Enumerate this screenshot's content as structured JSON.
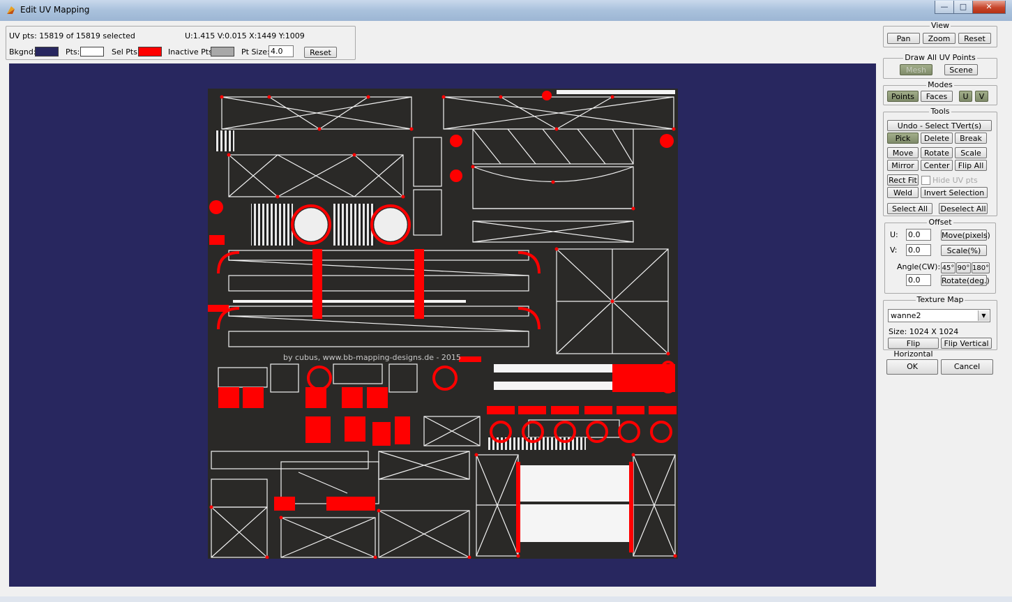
{
  "window": {
    "title": "Edit UV Mapping",
    "minimize": "—",
    "maximize": "□",
    "close": "✕"
  },
  "status": {
    "uv_pts": "UV pts: 15819 of 15819 selected",
    "coords": "U:1.415  V:0.015  X:1449  Y:1009",
    "bkgnd_label": "Bkgnd:",
    "pts_label": "Pts:",
    "sel_pts_label": "Sel Pts:",
    "inactive_pts_label": "Inactive Pts:",
    "pt_size_label": "Pt Size:",
    "pt_size_value": "4.0",
    "reset": "Reset"
  },
  "colors": {
    "background": "#28275f",
    "points": "#ffffff",
    "selected_points": "#ff0000",
    "inactive_points": "#a8a8a8"
  },
  "texture_credit": "by cubus, www.bb-mapping-designs.de - 2015",
  "panel": {
    "view": {
      "title": "View",
      "pan": "Pan",
      "zoom": "Zoom",
      "reset": "Reset"
    },
    "draw_all": {
      "title": "Draw All UV Points",
      "mesh": "Mesh",
      "scene": "Scene"
    },
    "modes": {
      "title": "Modes",
      "points": "Points",
      "faces": "Faces",
      "u": "U",
      "v": "V"
    },
    "tools": {
      "title": "Tools",
      "undo": "Undo - Select TVert(s)",
      "pick": "Pick",
      "delete": "Delete",
      "break": "Break",
      "move": "Move",
      "rotate": "Rotate",
      "scale": "Scale",
      "mirror": "Mirror",
      "center": "Center",
      "flip_all": "Flip All",
      "rect_fit": "Rect Fit",
      "hide_uv": "Hide UV pts",
      "weld": "Weld",
      "invert_selection": "Invert Selection",
      "select_all": "Select All",
      "deselect_all": "Deselect All"
    },
    "offset": {
      "title": "Offset",
      "u_label": "U:",
      "u_value": "0.0",
      "move_pixels": "Move(pixels)",
      "v_label": "V:",
      "v_value": "0.0",
      "scale_pct": "Scale(%)",
      "angle_label": "Angle(CW):",
      "a45": "45°",
      "a90": "90°",
      "a180": "180°",
      "angle_value": "0.0",
      "rotate_deg": "Rotate(deg.)"
    },
    "texture_map": {
      "title": "Texture Map",
      "selected": "wanne2",
      "size": "Size: 1024 X 1024",
      "flip_horizontal": "Flip Horizontal",
      "flip_vertical": "Flip Vertical"
    },
    "ok": "OK",
    "cancel": "Cancel"
  }
}
